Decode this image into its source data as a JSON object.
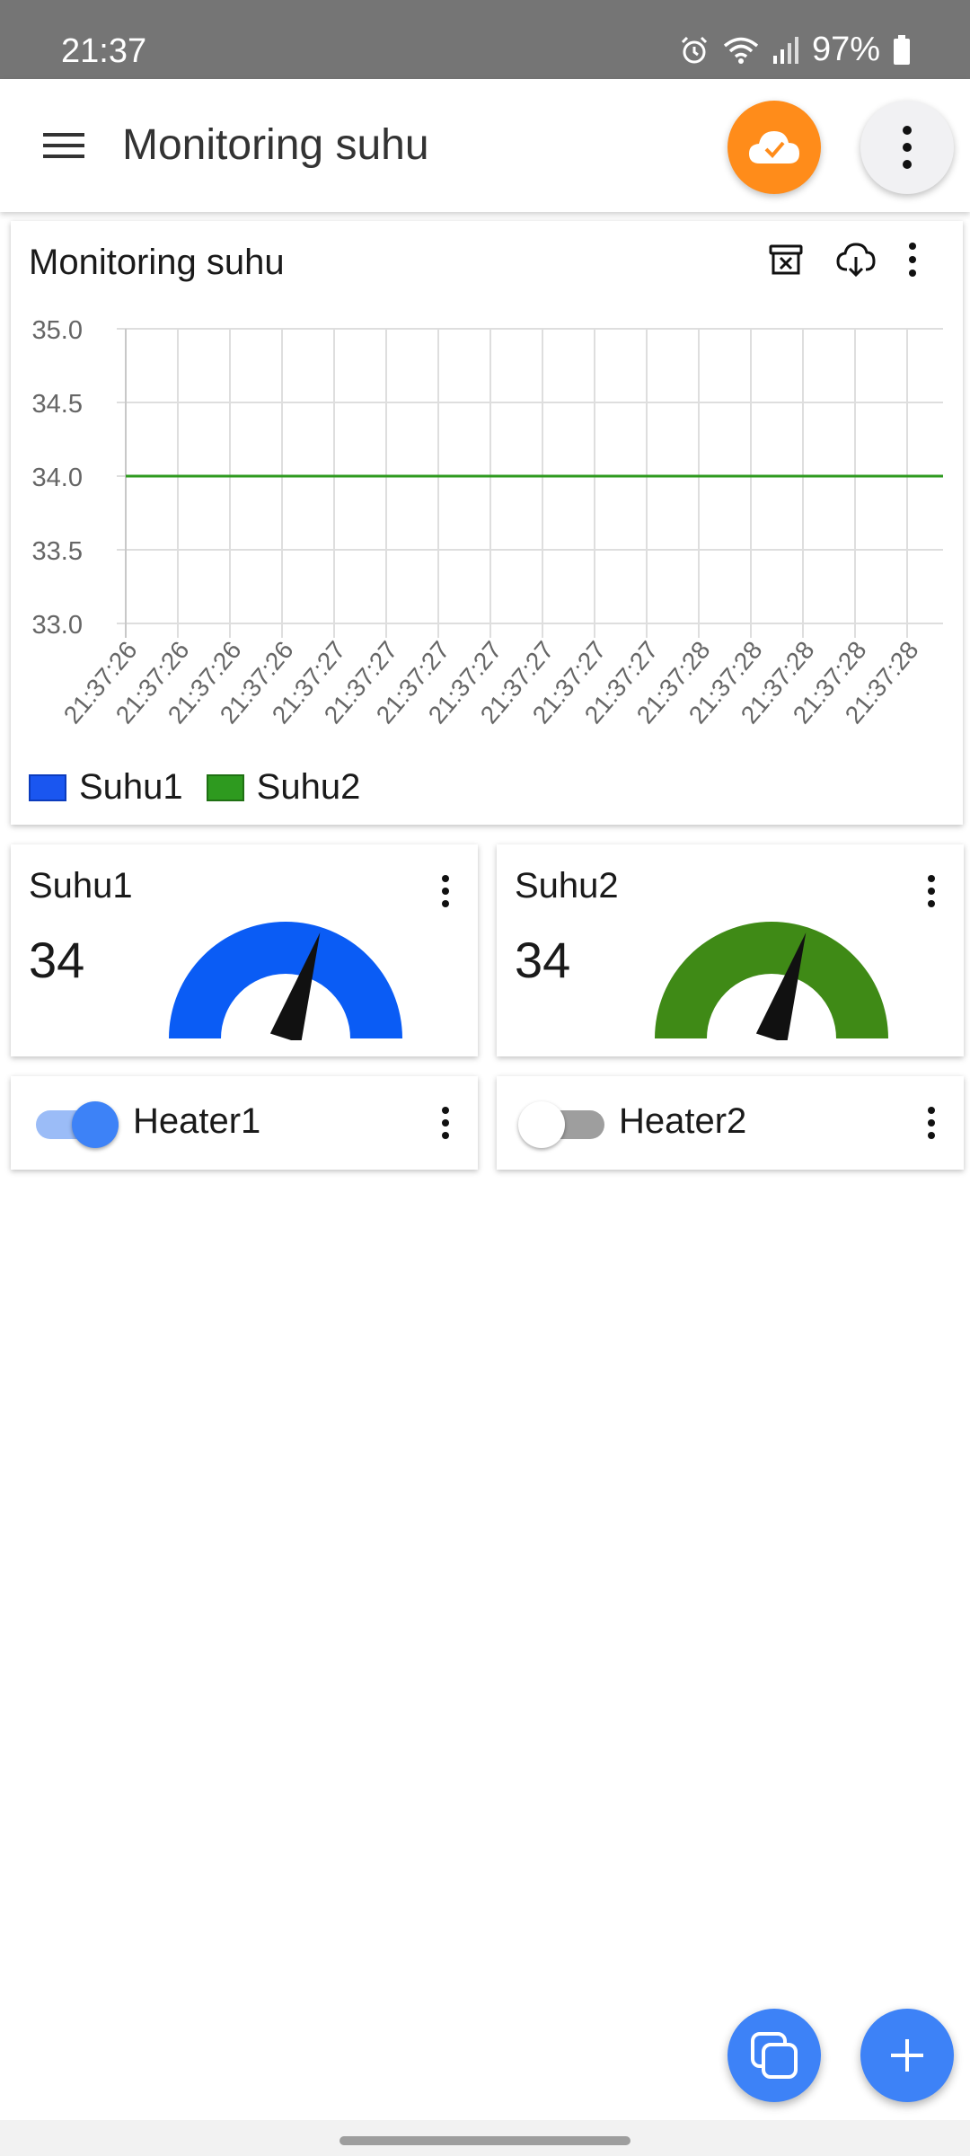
{
  "status_bar": {
    "time": "21:37",
    "battery": "97%"
  },
  "app_bar": {
    "title": "Monitoring suhu",
    "menu_icon": "hamburger-menu-icon",
    "cloud_icon": "cloud-check-icon",
    "more_icon": "more-vert-icon",
    "cloud_color": "#ff8c1a"
  },
  "chart_card": {
    "title": "Monitoring suhu",
    "actions": [
      "clear-data-icon",
      "cloud-download-icon",
      "more-vert-icon"
    ]
  },
  "chart_data": {
    "type": "line",
    "title": "Monitoring suhu",
    "x": [
      "21:37:26",
      "21:37:26",
      "21:37:26",
      "21:37:26",
      "21:37:27",
      "21:37:27",
      "21:37:27",
      "21:37:27",
      "21:37:27",
      "21:37:27",
      "21:37:27",
      "21:37:28",
      "21:37:28",
      "21:37:28",
      "21:37:28",
      "21:37:28"
    ],
    "series": [
      {
        "name": "Suhu1",
        "color": "#1a56f0",
        "values": [
          34,
          34,
          34,
          34,
          34,
          34,
          34,
          34,
          34,
          34,
          34,
          34,
          34,
          34,
          34,
          34
        ]
      },
      {
        "name": "Suhu2",
        "color": "#2e9a1f",
        "values": [
          34,
          34,
          34,
          34,
          34,
          34,
          34,
          34,
          34,
          34,
          34,
          34,
          34,
          34,
          34,
          34
        ]
      }
    ],
    "yticks": [
      "35.0",
      "34.5",
      "34.0",
      "33.5",
      "33.0"
    ],
    "ylim": [
      33.0,
      35.0
    ],
    "grid": true,
    "legend": "bottom-left"
  },
  "gauges": [
    {
      "title": "Suhu1",
      "value": "34",
      "color": "#0a5cf5",
      "level": 0.6
    },
    {
      "title": "Suhu2",
      "value": "34",
      "color": "#3f8a16",
      "level": 0.6
    }
  ],
  "switches": [
    {
      "label": "Heater1",
      "on": true
    },
    {
      "label": "Heater2",
      "on": false
    }
  ],
  "fabs": {
    "duplicate_icon": "copy-icon",
    "add_icon": "plus-icon"
  }
}
